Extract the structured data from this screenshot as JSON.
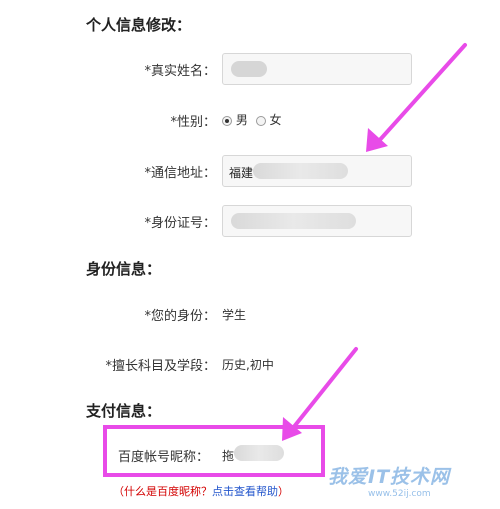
{
  "sections": {
    "personal": "个人信息修改：",
    "identity": "身份信息：",
    "payment": "支付信息："
  },
  "fields": {
    "real_name_label": "*真实姓名：",
    "gender_label": "*性别：",
    "gender_male": "男",
    "gender_female": "女",
    "gender_selected": "男",
    "address_label": "*通信地址：",
    "address_value": "福建",
    "id_label": "*身份证号：",
    "your_identity_label": "*您的身份：",
    "your_identity_value": "学生",
    "subjects_label": "*擅长科目及学段：",
    "subjects_value": "历史,初中",
    "baidu_nick_label": "百度帐号昵称：",
    "baidu_nick_value": "拖"
  },
  "help": {
    "open_paren": "（",
    "question": "什么是百度昵称？",
    "link": "点击查看帮助",
    "close_paren": "）"
  },
  "watermark": {
    "main": "我爱IT技术网",
    "sub": "www.52ij.com"
  },
  "colors": {
    "highlight": "#e84be8",
    "help_red": "#d30000",
    "help_link": "#2255cc"
  }
}
